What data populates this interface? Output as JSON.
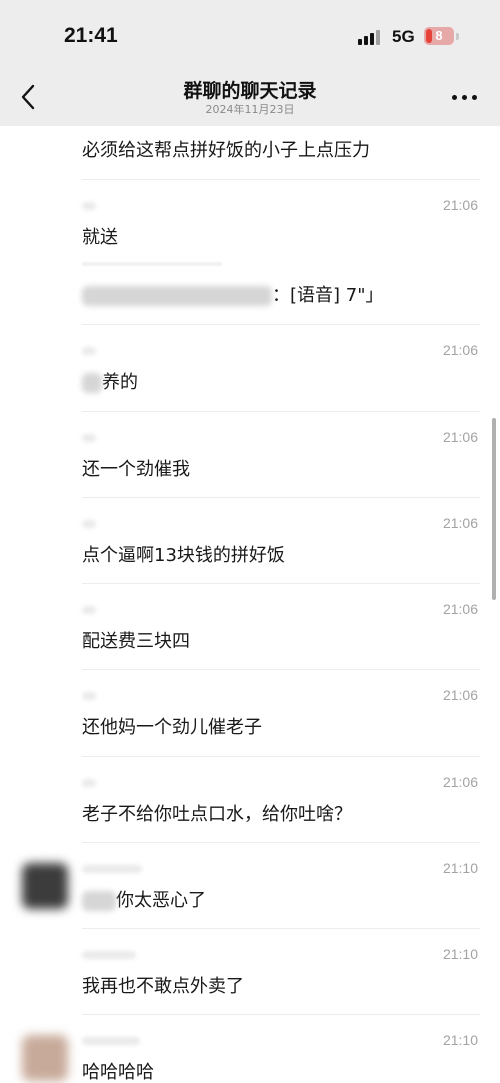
{
  "status_bar": {
    "time": "21:41",
    "network": "5G",
    "battery": "8",
    "battery_color": "#e5423a"
  },
  "header": {
    "back_icon": "chevron-left-icon",
    "title": "群聊的聊天记录",
    "subtitle": "2024年11月23日",
    "more_icon": "more-dots-icon"
  },
  "messages": [
    {
      "time": "",
      "text": "必须给这帮点拼好饭的小子上点压力",
      "sender_blurred": false
    },
    {
      "time": "21:06",
      "text": "就送",
      "sender_blurred": true
    },
    {
      "time": "",
      "text": "：[语音] 7\"」",
      "sender_blurred": true,
      "quoted": true
    },
    {
      "time": "21:06",
      "text": "养的",
      "sender_blurred": true,
      "prefix_blurred": true
    },
    {
      "time": "21:06",
      "text": "还一个劲催我",
      "sender_blurred": true
    },
    {
      "time": "21:06",
      "text": "点个逼啊13块钱的拼好饭",
      "sender_blurred": true
    },
    {
      "time": "21:06",
      "text": "配送费三块四",
      "sender_blurred": true
    },
    {
      "time": "21:06",
      "text": "还他妈一个劲儿催老子",
      "sender_blurred": true
    },
    {
      "time": "21:06",
      "text": "老子不给你吐点口水，给你吐啥？",
      "sender_blurred": true
    },
    {
      "time": "21:10",
      "text": "你太恶心了",
      "sender_blurred": true,
      "prefix_blurred": true,
      "avatar": true
    },
    {
      "time": "21:10",
      "text": "我再也不敢点外卖了",
      "sender_blurred": true
    },
    {
      "time": "21:10",
      "text": "哈哈哈哈",
      "sender_blurred": true,
      "avatar": true
    }
  ]
}
